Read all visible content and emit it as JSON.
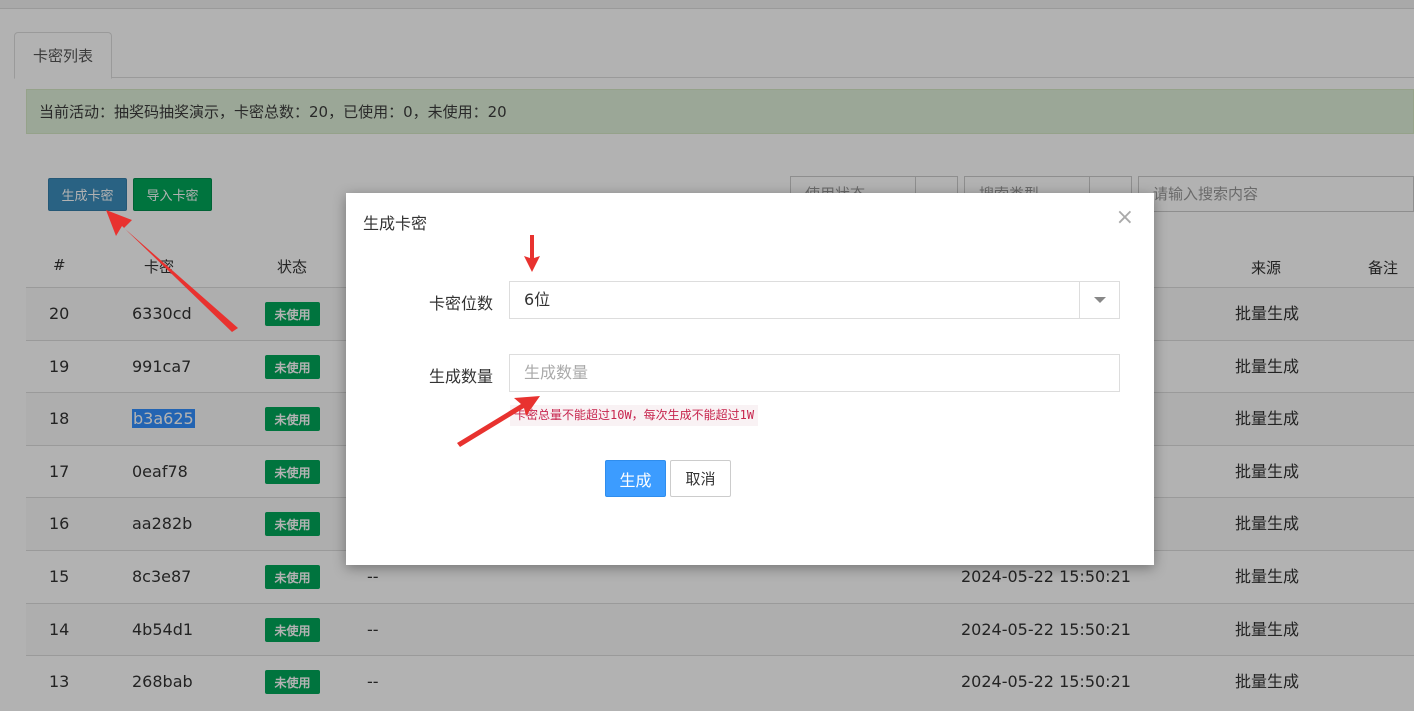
{
  "tabs": [
    {
      "label": "卡密列表"
    }
  ],
  "alert": {
    "text": "当前活动：抽奖码抽奖演示，卡密总数：20，已使用：0，未使用：20"
  },
  "toolbar": {
    "generate_label": "生成卡密",
    "import_label": "导入卡密"
  },
  "filters": {
    "use_status": "使用状态",
    "search_type": "搜索类型",
    "search_placeholder": "请输入搜索内容"
  },
  "table": {
    "headers": [
      "#",
      "卡密",
      "状态",
      "来源",
      "备注"
    ],
    "rows": [
      {
        "id": "20",
        "code": "6330cd",
        "status": "未使用",
        "remark": "",
        "time": "",
        "source": "批量生成"
      },
      {
        "id": "19",
        "code": "991ca7",
        "status": "未使用",
        "remark": "",
        "time": "",
        "source": "批量生成"
      },
      {
        "id": "18",
        "code": "b3a625",
        "status": "未使用",
        "remark": "",
        "time": "",
        "source": "批量生成"
      },
      {
        "id": "17",
        "code": "0eaf78",
        "status": "未使用",
        "remark": "",
        "time": "",
        "source": "批量生成"
      },
      {
        "id": "16",
        "code": "aa282b",
        "status": "未使用",
        "remark": "",
        "time": "",
        "source": "批量生成"
      },
      {
        "id": "15",
        "code": "8c3e87",
        "status": "未使用",
        "remark": "--",
        "time": "2024-05-22 15:50:21",
        "source": "批量生成"
      },
      {
        "id": "14",
        "code": "4b54d1",
        "status": "未使用",
        "remark": "--",
        "time": "2024-05-22 15:50:21",
        "source": "批量生成"
      },
      {
        "id": "13",
        "code": "268bab",
        "status": "未使用",
        "remark": "--",
        "time": "2024-05-22 15:50:21",
        "source": "批量生成"
      }
    ]
  },
  "modal": {
    "title": "生成卡密",
    "close_glyph": "×",
    "length_label": "卡密位数",
    "length_value": "6位",
    "count_label": "生成数量",
    "count_placeholder": "生成数量",
    "hint": "卡密总量不能超过10W，每次生成不能超过1W",
    "ok_label": "生成",
    "cancel_label": "取消"
  },
  "colors": {
    "primary": "#3c8dbc",
    "success": "#00a65a",
    "modal_ok": "#3c9cff",
    "annotation_arrow": "#e8322f"
  }
}
